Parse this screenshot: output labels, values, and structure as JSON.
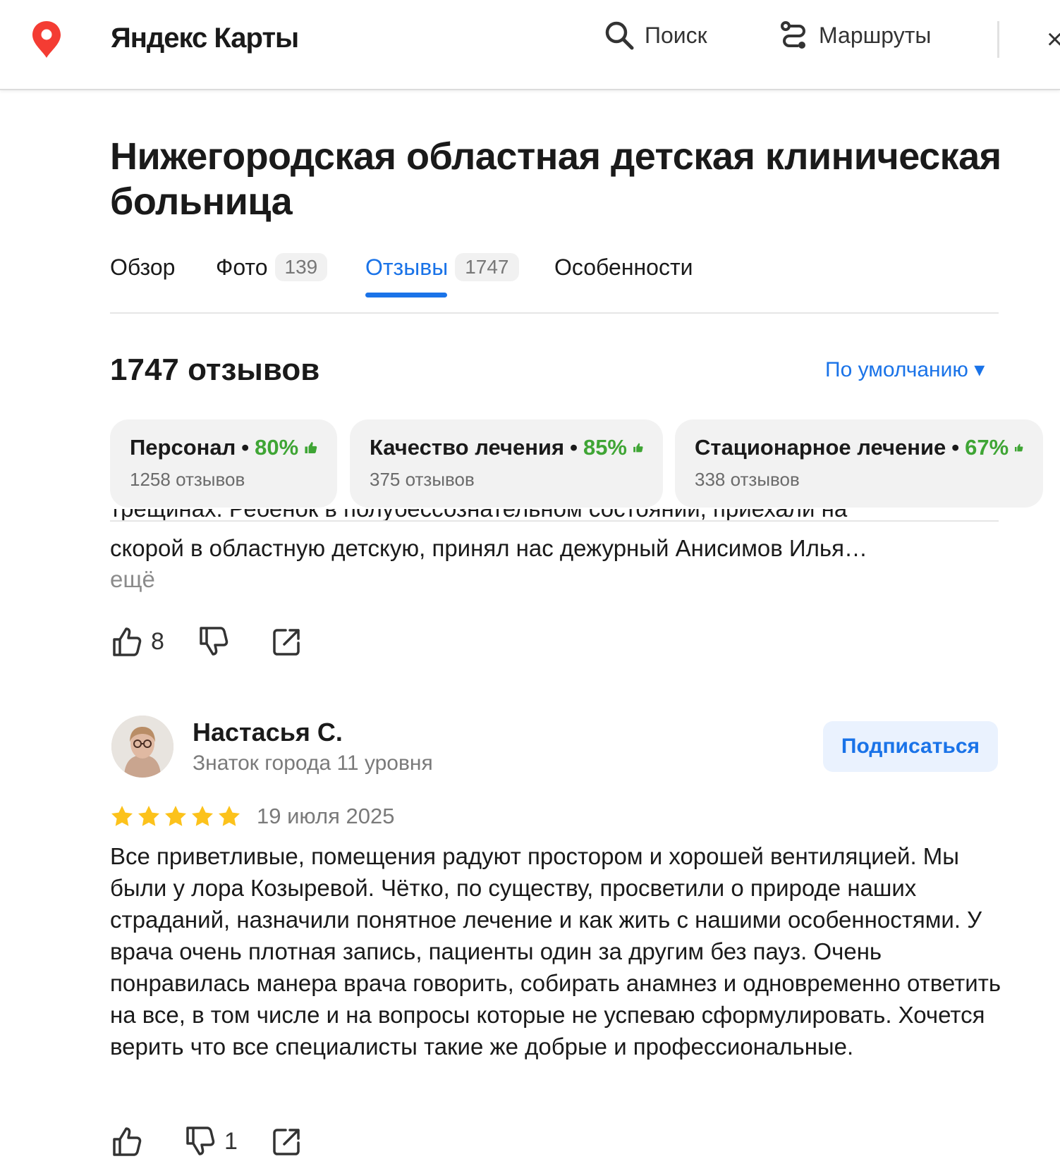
{
  "header": {
    "brand": "Яндекс Карты",
    "search_label": "Поиск",
    "routes_label": "Маршруты",
    "close_glyph": "×"
  },
  "org": {
    "title": "Нижегородская областная детская клиническая больница"
  },
  "tabs": [
    {
      "label": "Обзор",
      "count": ""
    },
    {
      "label": "Фото",
      "count": "139"
    },
    {
      "label": "Отзывы",
      "count": "1747"
    },
    {
      "label": "Особенности",
      "count": ""
    }
  ],
  "reviews_header": {
    "count_title": "1747 отзывов",
    "sort_label": "По умолчанию ▾"
  },
  "aspects": [
    {
      "name": "Персонал",
      "percent": "80%",
      "reviews": "1258 отзывов"
    },
    {
      "name": "Качество лечения",
      "percent": "85%",
      "reviews": "375 отзывов"
    },
    {
      "name": "Стационарное лечение",
      "percent": "67%",
      "reviews": "338 отзывов"
    }
  ],
  "review1": {
    "cut_line": "трещинах. Ребенок в полубессознательном состоянии, приехали на",
    "text": "скорой в областную детскую, принял нас дежурный Анисимов Илья…",
    "more": "ещё",
    "likes": "8",
    "dislikes": ""
  },
  "review2": {
    "author": "Настасья С.",
    "level": "Знаток города 11 уровня",
    "subscribe_label": "Подписаться",
    "rating": 5,
    "date": "19 июля 2025",
    "text": "Все приветливые, помещения радуют простором и хорошей вентиляцией. Мы были у лора Козыревой. Чётко, по существу, просветили о природе наших страданий, назначили понятное лечение и как жить с нашими особенностями. У врача очень плотная запись, пациенты один за другим без пауз. Очень понравилась манера врача говорить, собирать анамнез и одновременно ответить на все, в том числе и на вопросы которые не успеваю сформулировать. Хочется верить что все специалисты такие же добрые и профессиональные.",
    "likes": "",
    "dislikes": "1"
  },
  "colors": {
    "accent": "#1a73e8",
    "positive": "#3fa535",
    "star": "#fcc21b",
    "pin": "#f43c33"
  }
}
